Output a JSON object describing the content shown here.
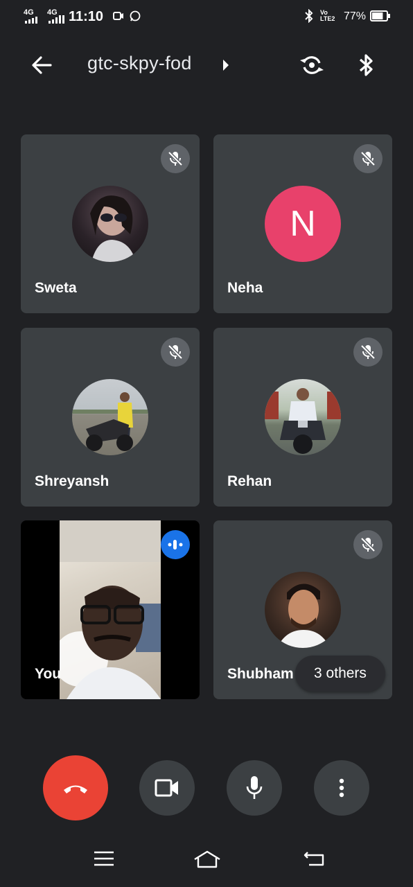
{
  "status_bar": {
    "network1": "4G",
    "network2": "4G",
    "time": "11:10",
    "volte": "Vo LTE2",
    "battery": "77%",
    "battery_level": 0.77
  },
  "header": {
    "meeting_code": "gtc-skpy-fod",
    "icons": [
      "back-arrow-icon",
      "chevron-right-icon",
      "switch-camera-icon",
      "bluetooth-icon"
    ]
  },
  "participants": [
    {
      "name": "Sweta",
      "muted": true,
      "avatar": "photo"
    },
    {
      "name": "Neha",
      "muted": true,
      "avatar": "initial",
      "initial": "N",
      "color": "#e8416b"
    },
    {
      "name": "Shreyansh",
      "muted": true,
      "avatar": "photo"
    },
    {
      "name": "Rehan",
      "muted": true,
      "avatar": "photo"
    },
    {
      "name": "You",
      "muted": false,
      "speaking": true,
      "avatar": "video"
    },
    {
      "name": "Shubham",
      "muted": true,
      "avatar": "photo"
    }
  ],
  "others_chip": "3 others",
  "controls": {
    "end_call_color": "#ea4335",
    "items": [
      "end-call-icon",
      "camera-icon",
      "microphone-icon",
      "more-vert-icon"
    ]
  },
  "speaking_color": "#1a73e8"
}
